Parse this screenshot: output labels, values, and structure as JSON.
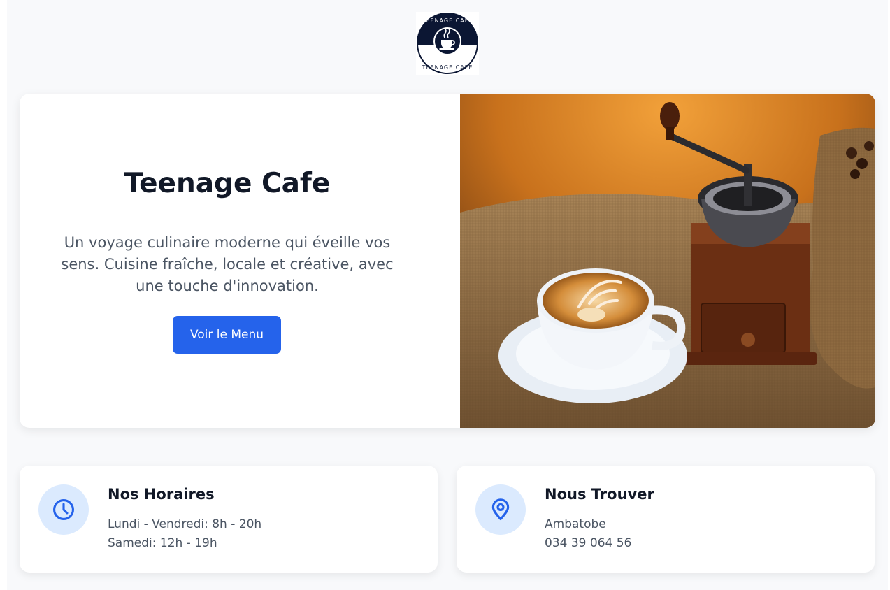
{
  "brand": {
    "logo_text": "TEENAGE CAFE",
    "accent": "#2563eb"
  },
  "hero": {
    "title": "Teenage Cafe",
    "description": "Un voyage culinaire moderne qui éveille vos sens. Cuisine fraîche, locale et créative, avec une touche d'innovation.",
    "button_label": "Voir le Menu",
    "image_icon": "coffee-grinder-latte-photo"
  },
  "hours": {
    "icon": "clock-icon",
    "title": "Nos Horaires",
    "lines": [
      "Lundi - Vendredi: 8h - 20h",
      "Samedi: 12h - 19h"
    ]
  },
  "location": {
    "icon": "map-pin-icon",
    "title": "Nous Trouver",
    "lines": [
      "Ambatobe",
      "034 39 064 56"
    ]
  }
}
